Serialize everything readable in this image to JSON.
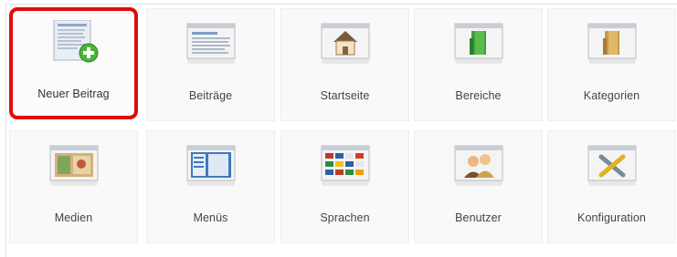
{
  "tiles": [
    {
      "label": "Neuer Beitrag",
      "icon": "new-article-icon",
      "highlighted": true
    },
    {
      "label": "Beiträge",
      "icon": "articles-icon"
    },
    {
      "label": "Startseite",
      "icon": "home-icon"
    },
    {
      "label": "Bereiche",
      "icon": "sections-icon"
    },
    {
      "label": "Kategorien",
      "icon": "categories-icon"
    },
    {
      "label": "Medien",
      "icon": "media-icon"
    },
    {
      "label": "Menüs",
      "icon": "menus-icon"
    },
    {
      "label": "Sprachen",
      "icon": "languages-icon"
    },
    {
      "label": "Benutzer",
      "icon": "users-icon"
    },
    {
      "label": "Konfiguration",
      "icon": "configuration-icon"
    }
  ],
  "colors": {
    "highlight": "#e10b0b",
    "tile_bg": "#f9f9f9",
    "label": "#444444"
  }
}
